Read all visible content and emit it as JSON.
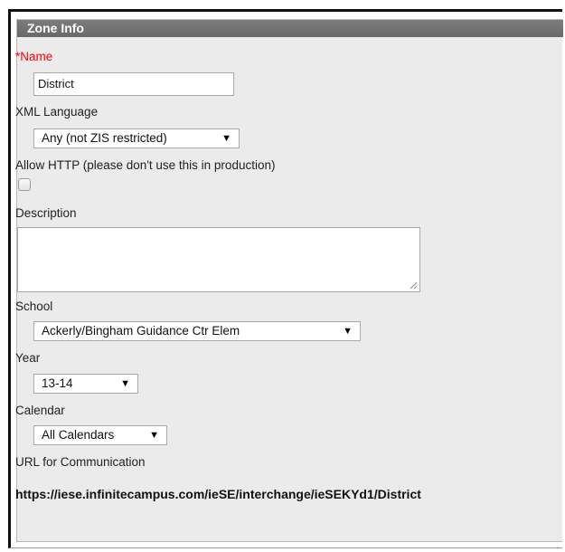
{
  "panel": {
    "title": "Zone Info"
  },
  "fields": {
    "name": {
      "label": "*Name",
      "value": "District"
    },
    "xml_language": {
      "label": "XML Language",
      "selected": "Any (not ZIS restricted)"
    },
    "allow_http": {
      "label": "Allow HTTP (please don't use this in production)",
      "checked": false
    },
    "description": {
      "label": "Description",
      "value": ""
    },
    "school": {
      "label": "School",
      "selected": "Ackerly/Bingham Guidance Ctr Elem"
    },
    "year": {
      "label": "Year",
      "selected": "13-14"
    },
    "calendar": {
      "label": "Calendar",
      "selected": "All Calendars"
    },
    "url": {
      "label": "URL for Communication",
      "value": "https://iese.infinitecampus.com/ieSE/interchange/ieSEKYd1/District"
    }
  },
  "icons": {
    "dropdown_arrow": "▼",
    "resize_grip": "resize-grip-icon"
  },
  "colors": {
    "header_bg": "#737373",
    "panel_bg": "#ebebeb",
    "required_label": "#ff0000"
  }
}
